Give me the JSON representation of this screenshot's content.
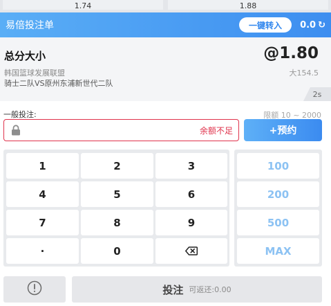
{
  "odds_strip": [
    "1.74",
    "1.88"
  ],
  "header": {
    "title": "易倍投注单",
    "transfer_label": "一键转入",
    "balance": "0.0"
  },
  "bet": {
    "market": "总分大小",
    "odds": "@1.80",
    "league": "韩国篮球发展联盟",
    "line": "大154.5",
    "match": "骑士二队VS原州东浦新世代二队",
    "timer": "2s"
  },
  "stake": {
    "label": "一般投注:",
    "limit": "限额 10 ~ 2000",
    "error": "余额不足",
    "reserve_label": "+预约"
  },
  "keypad": {
    "keys": [
      "1",
      "2",
      "3",
      "4",
      "5",
      "6",
      "7",
      "8",
      "9",
      "·",
      "0"
    ],
    "quick": [
      "100",
      "200",
      "500",
      "MAX"
    ]
  },
  "footer": {
    "bet_label": "投注",
    "return_label": "可返还:0.00"
  },
  "colors": {
    "accent": "#3d8ef0",
    "error": "#e0334c",
    "quick_text": "#8cc2f3"
  }
}
